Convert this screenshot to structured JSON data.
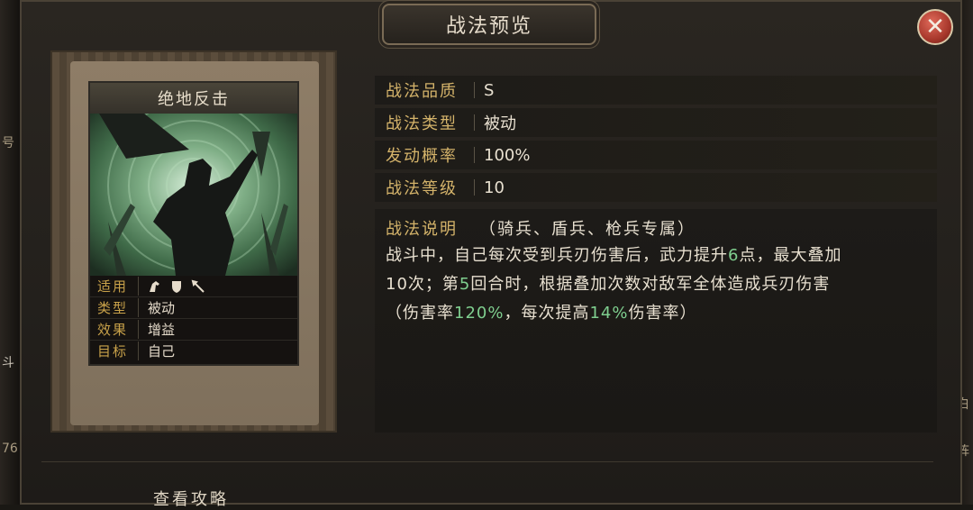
{
  "background": {
    "left_edge": [
      "号",
      "斗",
      "76"
    ],
    "right_edge": [
      "白",
      "阵"
    ]
  },
  "window": {
    "title": "战法预览",
    "close_icon": "close-icon"
  },
  "card": {
    "name": "绝地反击",
    "info": [
      {
        "label": "适用",
        "value": ""
      },
      {
        "label": "类型",
        "value": "被动"
      },
      {
        "label": "效果",
        "value": "增益"
      },
      {
        "label": "目标",
        "value": "自己"
      }
    ],
    "troop_icons": [
      "cavalry-icon",
      "shield-icon",
      "spear-icon"
    ]
  },
  "attributes": [
    {
      "label": "战法品质",
      "value": "S"
    },
    {
      "label": "战法类型",
      "value": "被动"
    },
    {
      "label": "发动概率",
      "value": "100%"
    },
    {
      "label": "战法等级",
      "value": "10"
    }
  ],
  "description": {
    "label": "战法说明",
    "tag": "（骑兵、盾兵、枪兵专属）",
    "line1_a": "战斗中，自己每次受到兵刃伤害后，武力提升",
    "line1_hl": "6",
    "line1_b": "点，最大叠加",
    "line2_a": "10次；第",
    "line2_hl": "5",
    "line2_b": "回合时，根据叠加次数对敌军全体造成兵刃伤害",
    "line3_a": "（伤害率",
    "line3_hl1": "120%",
    "line3_b": "，每次提高",
    "line3_hl2": "14%",
    "line3_c": "伤害率）"
  },
  "footer": {
    "guide_label": "查看攻略"
  },
  "colors": {
    "gold_label": "#d4b36a",
    "highlight_green": "#7fcf8f",
    "close_red": "#a8382c"
  }
}
